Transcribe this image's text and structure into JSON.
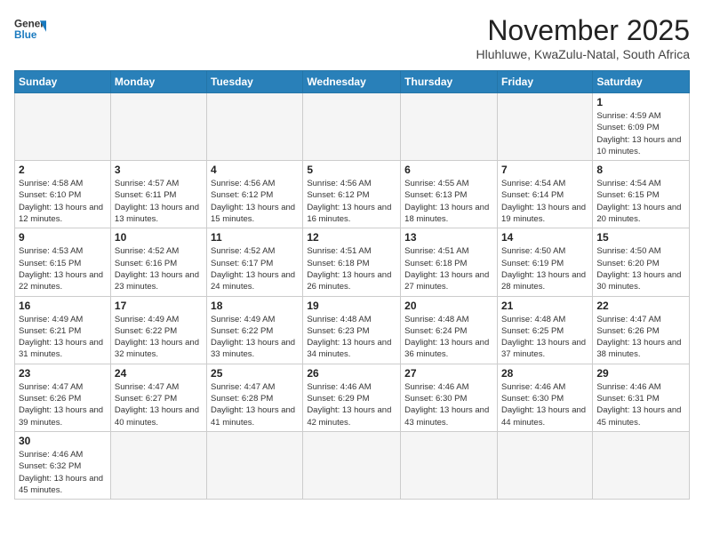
{
  "header": {
    "logo_general": "General",
    "logo_blue": "Blue",
    "month_title": "November 2025",
    "subtitle": "Hluhluwe, KwaZulu-Natal, South Africa"
  },
  "weekdays": [
    "Sunday",
    "Monday",
    "Tuesday",
    "Wednesday",
    "Thursday",
    "Friday",
    "Saturday"
  ],
  "weeks": [
    [
      {
        "day": "",
        "empty": true
      },
      {
        "day": "",
        "empty": true
      },
      {
        "day": "",
        "empty": true
      },
      {
        "day": "",
        "empty": true
      },
      {
        "day": "",
        "empty": true
      },
      {
        "day": "",
        "empty": true
      },
      {
        "day": "1",
        "sunrise": "4:59 AM",
        "sunset": "6:09 PM",
        "daylight": "13 hours and 10 minutes."
      }
    ],
    [
      {
        "day": "2",
        "sunrise": "4:58 AM",
        "sunset": "6:10 PM",
        "daylight": "13 hours and 12 minutes."
      },
      {
        "day": "3",
        "sunrise": "4:57 AM",
        "sunset": "6:11 PM",
        "daylight": "13 hours and 13 minutes."
      },
      {
        "day": "4",
        "sunrise": "4:56 AM",
        "sunset": "6:12 PM",
        "daylight": "13 hours and 15 minutes."
      },
      {
        "day": "5",
        "sunrise": "4:56 AM",
        "sunset": "6:12 PM",
        "daylight": "13 hours and 16 minutes."
      },
      {
        "day": "6",
        "sunrise": "4:55 AM",
        "sunset": "6:13 PM",
        "daylight": "13 hours and 18 minutes."
      },
      {
        "day": "7",
        "sunrise": "4:54 AM",
        "sunset": "6:14 PM",
        "daylight": "13 hours and 19 minutes."
      },
      {
        "day": "8",
        "sunrise": "4:54 AM",
        "sunset": "6:15 PM",
        "daylight": "13 hours and 20 minutes."
      }
    ],
    [
      {
        "day": "9",
        "sunrise": "4:53 AM",
        "sunset": "6:15 PM",
        "daylight": "13 hours and 22 minutes."
      },
      {
        "day": "10",
        "sunrise": "4:52 AM",
        "sunset": "6:16 PM",
        "daylight": "13 hours and 23 minutes."
      },
      {
        "day": "11",
        "sunrise": "4:52 AM",
        "sunset": "6:17 PM",
        "daylight": "13 hours and 24 minutes."
      },
      {
        "day": "12",
        "sunrise": "4:51 AM",
        "sunset": "6:18 PM",
        "daylight": "13 hours and 26 minutes."
      },
      {
        "day": "13",
        "sunrise": "4:51 AM",
        "sunset": "6:18 PM",
        "daylight": "13 hours and 27 minutes."
      },
      {
        "day": "14",
        "sunrise": "4:50 AM",
        "sunset": "6:19 PM",
        "daylight": "13 hours and 28 minutes."
      },
      {
        "day": "15",
        "sunrise": "4:50 AM",
        "sunset": "6:20 PM",
        "daylight": "13 hours and 30 minutes."
      }
    ],
    [
      {
        "day": "16",
        "sunrise": "4:49 AM",
        "sunset": "6:21 PM",
        "daylight": "13 hours and 31 minutes."
      },
      {
        "day": "17",
        "sunrise": "4:49 AM",
        "sunset": "6:22 PM",
        "daylight": "13 hours and 32 minutes."
      },
      {
        "day": "18",
        "sunrise": "4:49 AM",
        "sunset": "6:22 PM",
        "daylight": "13 hours and 33 minutes."
      },
      {
        "day": "19",
        "sunrise": "4:48 AM",
        "sunset": "6:23 PM",
        "daylight": "13 hours and 34 minutes."
      },
      {
        "day": "20",
        "sunrise": "4:48 AM",
        "sunset": "6:24 PM",
        "daylight": "13 hours and 36 minutes."
      },
      {
        "day": "21",
        "sunrise": "4:48 AM",
        "sunset": "6:25 PM",
        "daylight": "13 hours and 37 minutes."
      },
      {
        "day": "22",
        "sunrise": "4:47 AM",
        "sunset": "6:26 PM",
        "daylight": "13 hours and 38 minutes."
      }
    ],
    [
      {
        "day": "23",
        "sunrise": "4:47 AM",
        "sunset": "6:26 PM",
        "daylight": "13 hours and 39 minutes."
      },
      {
        "day": "24",
        "sunrise": "4:47 AM",
        "sunset": "6:27 PM",
        "daylight": "13 hours and 40 minutes."
      },
      {
        "day": "25",
        "sunrise": "4:47 AM",
        "sunset": "6:28 PM",
        "daylight": "13 hours and 41 minutes."
      },
      {
        "day": "26",
        "sunrise": "4:46 AM",
        "sunset": "6:29 PM",
        "daylight": "13 hours and 42 minutes."
      },
      {
        "day": "27",
        "sunrise": "4:46 AM",
        "sunset": "6:30 PM",
        "daylight": "13 hours and 43 minutes."
      },
      {
        "day": "28",
        "sunrise": "4:46 AM",
        "sunset": "6:30 PM",
        "daylight": "13 hours and 44 minutes."
      },
      {
        "day": "29",
        "sunrise": "4:46 AM",
        "sunset": "6:31 PM",
        "daylight": "13 hours and 45 minutes."
      }
    ],
    [
      {
        "day": "30",
        "sunrise": "4:46 AM",
        "sunset": "6:32 PM",
        "daylight": "13 hours and 45 minutes."
      },
      {
        "day": "",
        "empty": true
      },
      {
        "day": "",
        "empty": true
      },
      {
        "day": "",
        "empty": true
      },
      {
        "day": "",
        "empty": true
      },
      {
        "day": "",
        "empty": true
      },
      {
        "day": "",
        "empty": true
      }
    ]
  ]
}
